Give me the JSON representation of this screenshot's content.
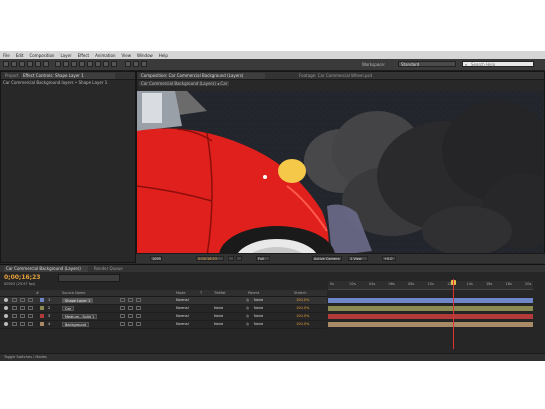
{
  "menu": [
    "File",
    "Edit",
    "Composition",
    "Layer",
    "Effect",
    "Animation",
    "View",
    "Window",
    "Help"
  ],
  "workspace": {
    "label": "Workspace:",
    "value": "Standard"
  },
  "search": {
    "placeholder": "Search Help"
  },
  "left_panel": {
    "tabs": [
      {
        "label": "Project"
      },
      {
        "label": "Effect Controls: Shape Layer 1"
      }
    ],
    "subtitle": "Car Commercial Background.layers • Shape Layer 1"
  },
  "viewer": {
    "tabs": [
      {
        "label": "Composition: Car Commercial Background (Layers)"
      },
      {
        "label": "Footage: Car Commercial Wheel.psd"
      }
    ],
    "breadcrumb": "Car Commercial Background (Layers) ◂ Car",
    "footer": {
      "zoom": "100%",
      "timecode": "0;00;16;23",
      "resolution": "Full",
      "camera": "Active Camera",
      "views": "1 View",
      "offset": "+0.0"
    }
  },
  "timeline": {
    "tabs": [
      {
        "label": "Car Commercial Background (Layers)"
      },
      {
        "label": "Render Queue"
      }
    ],
    "timecode": "0;00;16;23",
    "fps": "00503 (29.97 fps)",
    "columns": [
      "#",
      "Source Name",
      "Mode",
      "T",
      "TrkMat",
      "Parent",
      "Stretch"
    ],
    "ruler_ticks": [
      "0s",
      "02s",
      "04s",
      "06s",
      "08s",
      "10s",
      "12s",
      "14s",
      "16s",
      "18s",
      "20s"
    ],
    "layers": [
      {
        "num": "1",
        "name": "Shape Layer 1",
        "mode": "Normal",
        "trkmat": "",
        "parent": "None",
        "stretch": "100.0%",
        "color": "#6f86c9",
        "bar_color": "#6f86c9",
        "selected": true
      },
      {
        "num": "2",
        "name": "Car",
        "mode": "Normal",
        "trkmat": "None",
        "parent": "None",
        "stretch": "100.0%",
        "color": "#8a8a52",
        "bar_color": "#8a8a52",
        "selected": false
      },
      {
        "num": "3",
        "name": "Medium...Solid 1",
        "mode": "Normal",
        "trkmat": "None",
        "parent": "None",
        "stretch": "100.0%",
        "color": "#b33a3a",
        "bar_color": "#b33a3a",
        "selected": false
      },
      {
        "num": "4",
        "name": "Background",
        "mode": "Normal",
        "trkmat": "None",
        "parent": "None",
        "stretch": "100.0%",
        "color": "#a88a66",
        "bar_color": "#a88a66",
        "selected": false
      }
    ],
    "footer": "Toggle Switches / Modes"
  },
  "colors": {
    "accent": "#e8a33a",
    "car_red": "#e0201c",
    "background": "#23272e"
  }
}
